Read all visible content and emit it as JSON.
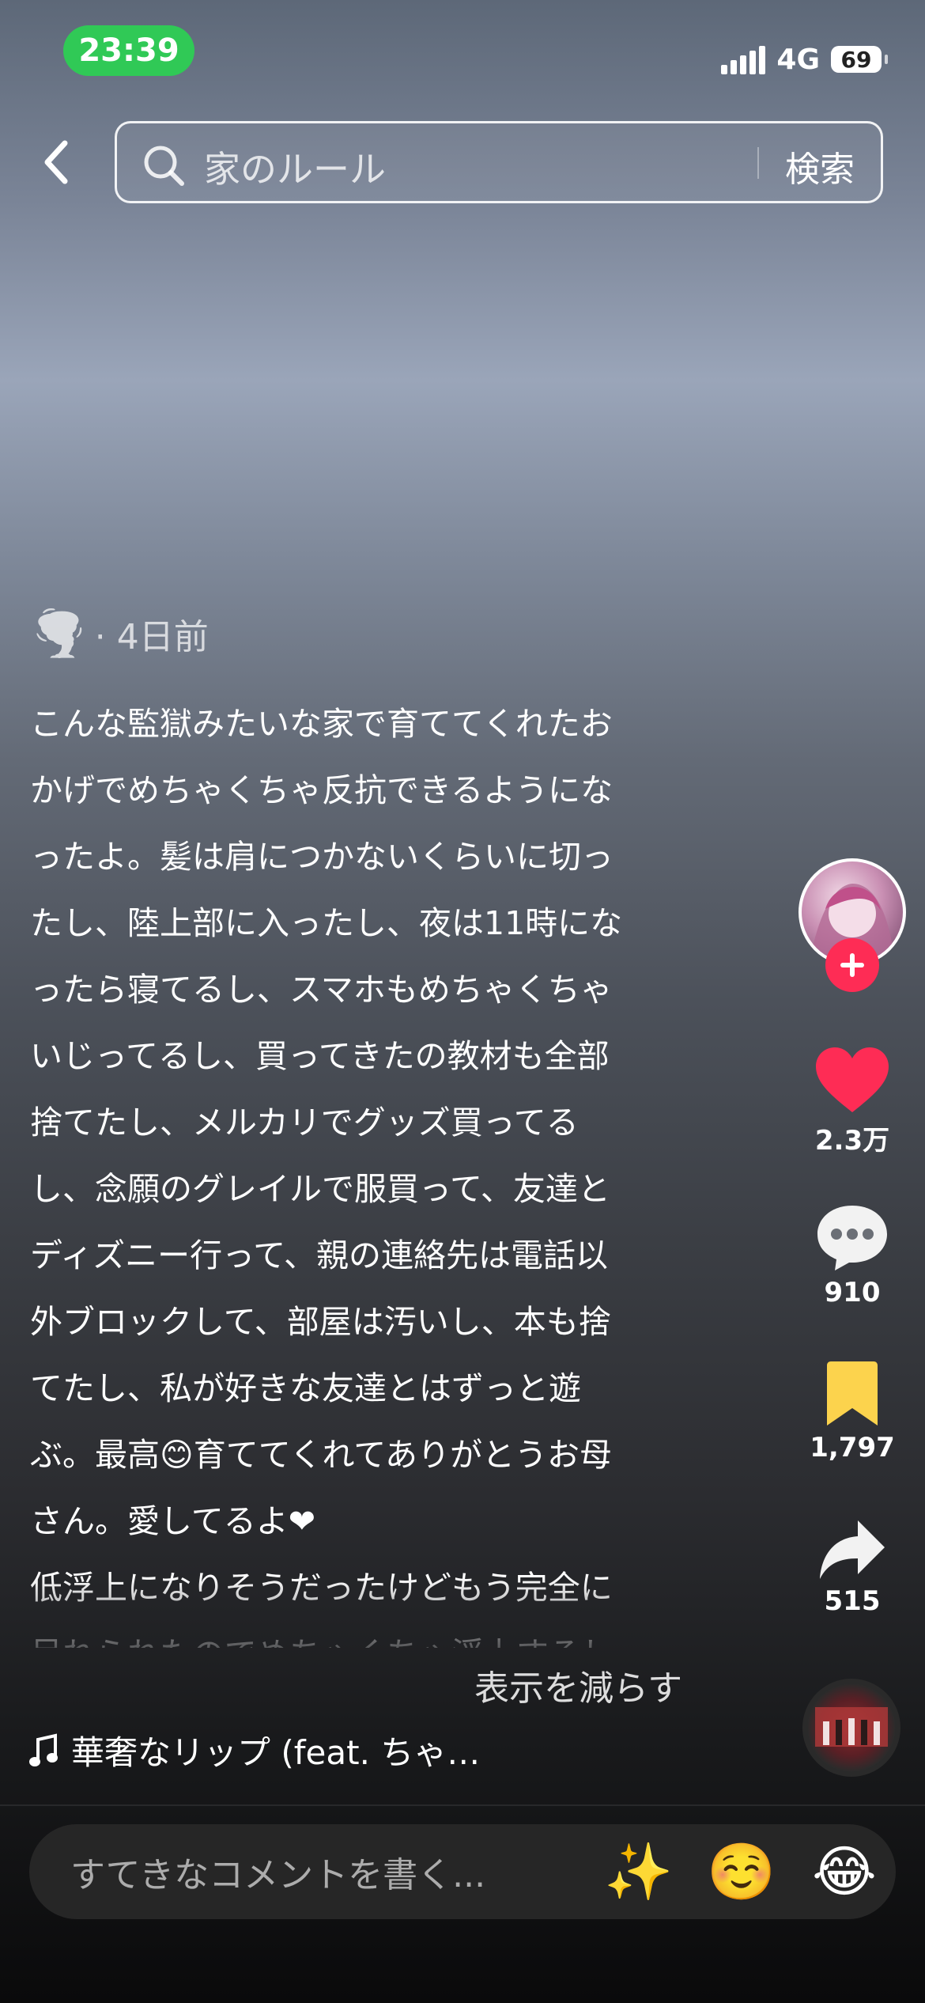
{
  "status_bar": {
    "time": "23:39",
    "network": "4G",
    "battery": "69"
  },
  "search": {
    "query": "家のルール",
    "button_label": "検索"
  },
  "post": {
    "author_icon": "🌪️",
    "time_ago": "· 4日前",
    "caption": "こんな監獄みたいな家で育ててくれたお\nかげでめちゃくちゃ反抗できるようにな\nったよ。髪は肩につかないくらいに切っ\nたし、陸上部に入ったし、夜は11時にな\nったら寝てるし、スマホもめちゃくちゃ\nいじってるし、買ってきたの教材も全部\n捨てたし、メルカリでグッズ買ってる\nし、念願のグレイルで服買って、友達と\nディズニー行って、親の連絡先は電話以\n外ブロックして、部屋は汚いし、本も捨\nてたし、私が好きな友達とはずっと遊\nぶ。最高😊育ててくれてありがとうお母\nさん。愛してるよ❤\n低浮上になりそうだったけどもう完全に\n呆れられたのでめちゃくちゃ浮上するし",
    "show_less": "表示を減らす",
    "music": "華奢なリップ (feat. ちゃ…"
  },
  "actions": {
    "likes": "2.3万",
    "comments": "910",
    "saves": "1,797",
    "shares": "515"
  },
  "comment_bar": {
    "placeholder": "すてきなコメントを書く...",
    "emojis": [
      "✨",
      "☺️",
      "😂"
    ]
  },
  "colors": {
    "accent": "#fe2c55",
    "save": "#fcd34d",
    "status_pill": "#30c956"
  }
}
